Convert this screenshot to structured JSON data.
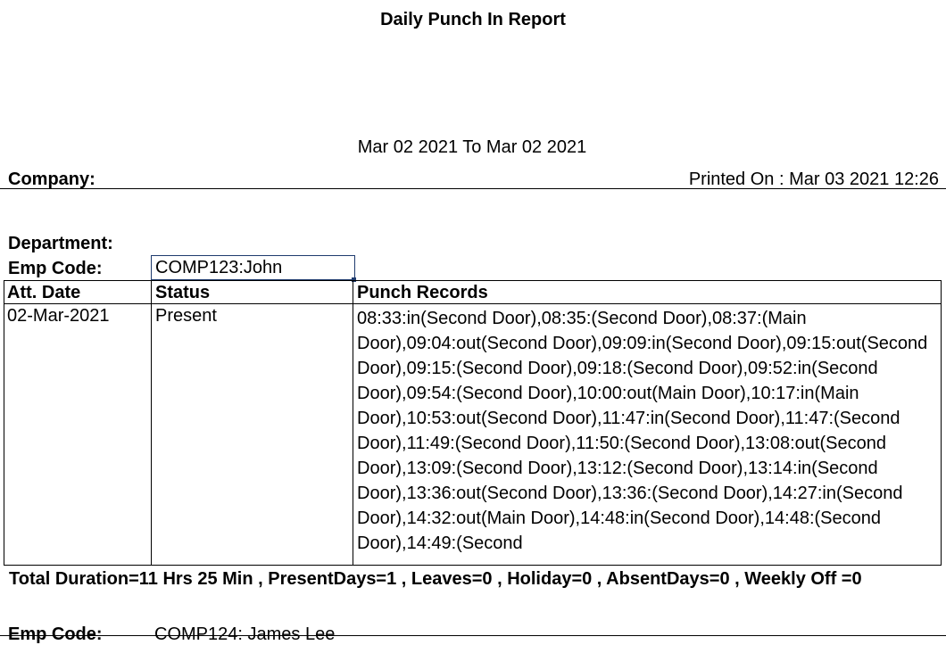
{
  "report": {
    "title": "Daily Punch In Report",
    "date_range": "Mar 02 2021  To  Mar 02 2021",
    "company_label": "Company:",
    "printed_on": "Printed On : Mar 03 2021 12:26"
  },
  "employee": {
    "department_label": "Department:",
    "emp_code_label": "Emp Code:",
    "emp_code_value": "COMP123:John"
  },
  "table": {
    "headers": [
      "Att. Date",
      "Status",
      "Punch Records"
    ],
    "row": {
      "date": "02-Mar-2021",
      "status": "Present",
      "punch_records": "08:33:in(Second Door),08:35:(Second Door),08:37:(Main Door),09:04:out(Second Door),09:09:in(Second Door),09:15:out(Second Door),09:15:(Second Door),09:18:(Second Door),09:52:in(Second Door),09:54:(Second Door),10:00:out(Main Door),10:17:in(Main Door),10:53:out(Second Door),11:47:in(Second Door),11:47:(Second Door),11:49:(Second Door),11:50:(Second Door),13:08:out(Second Door),13:09:(Second Door),13:12:(Second Door),13:14:in(Second Door),13:36:out(Second Door),13:36:(Second Door),14:27:in(Second Door),14:32:out(Main Door),14:48:in(Second Door),14:48:(Second Door),14:49:(Second"
    }
  },
  "summary": "Total Duration=11 Hrs 25 Min , PresentDays=1 , Leaves=0 , Holiday=0 , AbsentDays=0 , Weekly Off =0",
  "next_employee": {
    "emp_code_label": "Emp Code:",
    "emp_code_value": "COMP124: James Lee"
  },
  "colors": {
    "selection_border": "#1f3b6e"
  }
}
